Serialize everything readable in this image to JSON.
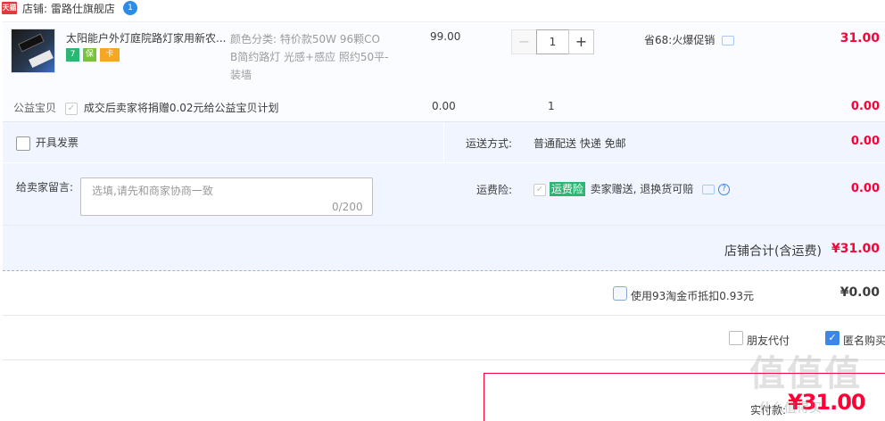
{
  "shop": {
    "logo_text": "天猫",
    "label": "店铺: 雷路仕旗舰店",
    "badge": "1"
  },
  "item": {
    "title": "太阳能户外灯庭院路灯家用新农...",
    "sku_line1": "颜色分类: 特价款50W 96颗CO",
    "sku_line2": "B简约路灯 光感+感应 照约50平-",
    "sku_line3": "装墙",
    "price": "99.00",
    "qty_minus": "−",
    "qty_value": "1",
    "qty_plus": "+",
    "promo": "省68:火爆促销",
    "subtotal": "31.00",
    "service_icons": [
      "7",
      "保",
      "卡"
    ]
  },
  "charity": {
    "label": "公益宝贝",
    "desc": "成交后卖家将捐赠0.02元给公益宝贝计划",
    "price": "0.00",
    "qty": "1",
    "subtotal": "0.00"
  },
  "invoice": {
    "label": "开具发票",
    "subtotal": "0.00"
  },
  "shipping": {
    "label": "运送方式:",
    "value": "普通配送 快递 免邮",
    "subtotal": "0.00"
  },
  "message": {
    "label": "给卖家留言:",
    "placeholder": "选填,请先和商家协商一致",
    "counter": "0/200"
  },
  "insurance": {
    "label": "运费险:",
    "tag": "运费险",
    "desc": "卖家赠送, 退换货可赔",
    "subtotal": "0.00"
  },
  "shop_total": {
    "label": "店铺合计(含运费)",
    "value": "¥31.00"
  },
  "coins": {
    "label": "使用93淘金币抵扣0.93元",
    "value": "¥0.00"
  },
  "friend_pay": {
    "label": "朋友代付"
  },
  "anonymous": {
    "label": "匿名购买",
    "checked_mark": "✓"
  },
  "pay": {
    "label": "实付款:",
    "value": "¥31.00"
  },
  "watermark": {
    "big": "值值值",
    "small": "什么值得买"
  },
  "colors": {
    "accent_red": "#ff0036",
    "accent_blue": "#3a87e6",
    "options_bg": "#f0f5ff"
  }
}
